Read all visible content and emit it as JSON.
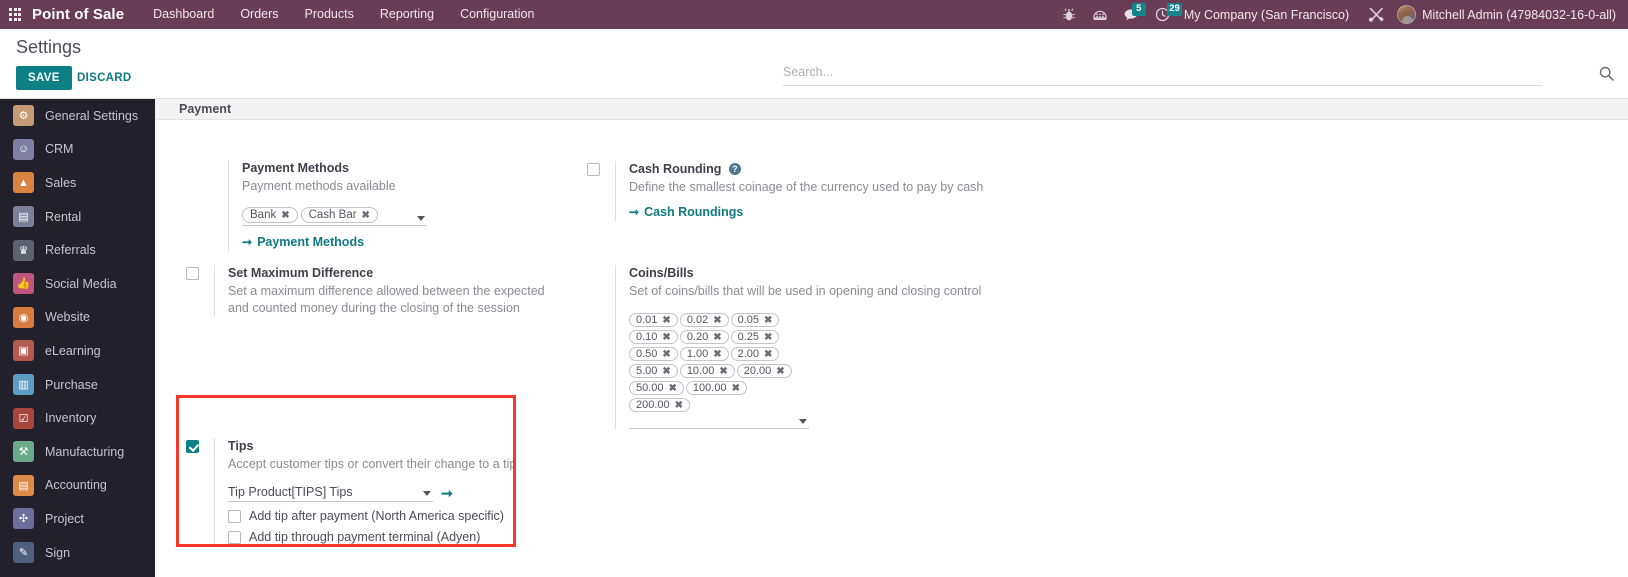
{
  "navbar": {
    "brand": "Point of Sale",
    "menu": [
      "Dashboard",
      "Orders",
      "Products",
      "Reporting",
      "Configuration"
    ],
    "icons": [
      {
        "name": "bug-icon",
        "glyph": "bug"
      },
      {
        "name": "phone-dialpad-icon",
        "glyph": "dialpad"
      },
      {
        "name": "messages-icon",
        "glyph": "chat",
        "badge": "5"
      },
      {
        "name": "activities-clock-icon",
        "glyph": "clock",
        "badge": "29"
      }
    ],
    "company": "My Company (San Francisco)",
    "tools_icon": "tools-icon",
    "user": "Mitchell Admin (47984032-16-0-all)"
  },
  "control_panel": {
    "title": "Settings",
    "save_label": "SAVE",
    "discard_label": "DISCARD",
    "search_placeholder": "Search...",
    "search_value": ""
  },
  "sidebar": {
    "items": [
      {
        "label": "General Settings",
        "icon_color": "#c59a74",
        "glyph": "⚙"
      },
      {
        "label": "CRM",
        "icon_color": "#7e7fa3",
        "glyph": "☺"
      },
      {
        "label": "Sales",
        "icon_color": "#d9833f",
        "glyph": "↗"
      },
      {
        "label": "Rental",
        "icon_color": "#7c8098",
        "glyph": "▤"
      },
      {
        "label": "Referrals",
        "icon_color": "#5c6370",
        "glyph": "♜"
      },
      {
        "label": "Social Media",
        "icon_color": "#c0567e",
        "glyph": "☝"
      },
      {
        "label": "Website",
        "icon_color": "#d97b3f",
        "glyph": "◔"
      },
      {
        "label": "eLearning",
        "icon_color": "#b25b4e",
        "glyph": "▣"
      },
      {
        "label": "Purchase",
        "icon_color": "#5e9cc4",
        "glyph": "▥"
      },
      {
        "label": "Inventory",
        "icon_color": "#a8463e",
        "glyph": "✉"
      },
      {
        "label": "Manufacturing",
        "icon_color": "#6aa98a",
        "glyph": "⚒"
      },
      {
        "label": "Accounting",
        "icon_color": "#dd8a46",
        "glyph": "⌸"
      },
      {
        "label": "Project",
        "icon_color": "#6e6e9c",
        "glyph": "✣"
      },
      {
        "label": "Sign",
        "icon_color": "#4f5f7d",
        "glyph": "✎"
      }
    ]
  },
  "main": {
    "section_title": "Payment",
    "payment_methods": {
      "title": "Payment Methods",
      "desc": "Payment methods available",
      "tags": [
        "Bank",
        "Cash Bar"
      ],
      "link": "Payment Methods"
    },
    "max_difference": {
      "title": "Set Maximum Difference",
      "desc": "Set a maximum difference allowed between the expected and counted money during the closing of the session",
      "checked": false
    },
    "cash_rounding": {
      "title": "Cash Rounding",
      "desc": "Define the smallest coinage of the currency used to pay by cash",
      "link": "Cash Roundings",
      "help": "?",
      "checked": false
    },
    "coins_bills": {
      "title": "Coins/Bills",
      "desc": "Set of coins/bills that will be used in opening and closing control",
      "tags": [
        "0.01",
        "0.02",
        "0.05",
        "0.10",
        "0.20",
        "0.25",
        "0.50",
        "1.00",
        "2.00",
        "5.00",
        "10.00",
        "20.00",
        "50.00",
        "100.00",
        "200.00"
      ]
    },
    "tips": {
      "title": "Tips",
      "desc": "Accept customer tips or convert their change to a tip",
      "checked": true,
      "product_label": "Tip Product",
      "product_value": "[TIPS] Tips",
      "options": [
        {
          "label": "Add tip after payment (North America specific)",
          "checked": false
        },
        {
          "label": "Add tip through payment terminal (Adyen)",
          "checked": false
        }
      ]
    }
  },
  "colors": {
    "navbar_bg": "#6a3d56",
    "accent": "#0d8086",
    "highlight_box": "#f4372a",
    "sidebar_bg": "#22212b"
  }
}
